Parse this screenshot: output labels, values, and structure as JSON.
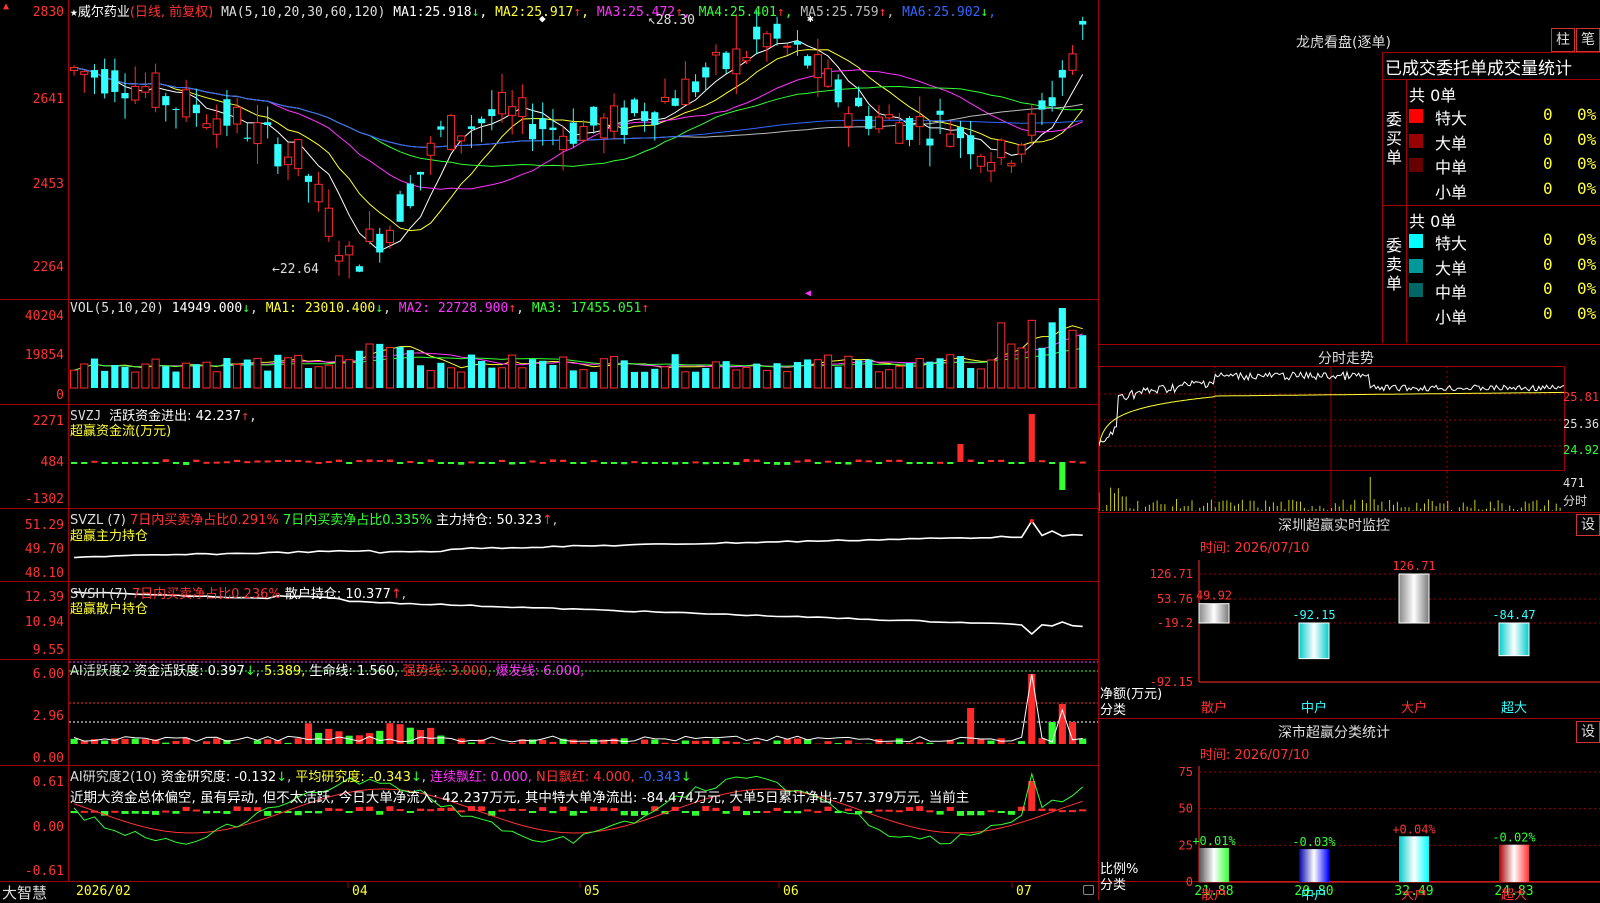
{
  "colors": {
    "up": "#ff2b2b",
    "down": "#33ffff",
    "ma1": "#ffffff",
    "ma2": "#ffff33",
    "ma3": "#ff33ff",
    "ma4": "#33ff33",
    "ma5": "#bbbbbb",
    "ma6": "#3366ff",
    "border": "#a00000"
  },
  "stock": {
    "name": "威尔药业",
    "mode": "(日线, 前复权)",
    "star": "★",
    "flag": "▲"
  },
  "main": {
    "ma_label": "MA(5,10,20,30,60,120)",
    "ma": [
      {
        "label": "MA1:",
        "value": "25.918",
        "arrow": "↓",
        "color": "#ffffff"
      },
      {
        "label": "MA2:",
        "value": "25.917",
        "arrow": "↑",
        "color": "#ffff33"
      },
      {
        "label": "MA3:",
        "value": "25.472",
        "arrow": "↑",
        "color": "#ff33ff"
      },
      {
        "label": "MA4:",
        "value": "25.401",
        "arrow": "↑",
        "color": "#33ff33"
      },
      {
        "label": "MA5:",
        "value": "25.759",
        "arrow": "↑",
        "color": "#bbbbbb"
      },
      {
        "label": "MA6:",
        "value": "25.902",
        "arrow": "↓",
        "color": "#3366ff"
      }
    ],
    "yticks": [
      "2830",
      "2641",
      "2453",
      "2264"
    ],
    "high_label": "28.30",
    "low_label": "22.64",
    "ymin": 22.2,
    "ymax": 28.6
  },
  "vol": {
    "label": "VOL(5,10,20)",
    "value": "14949.000",
    "arrow": "↓",
    "ma1": "MA1: 23010.400",
    "ma1_arrow": "↓",
    "ma2": "MA2: 22728.900",
    "ma2_arrow": "↑",
    "ma3": "MA3: 17455.051",
    "ma3_arrow": "↑",
    "yticks": [
      "40204",
      "19854",
      "0"
    ]
  },
  "svzj": {
    "label": "SVZJ",
    "item": "活跃资金进出: 42.237",
    "arrow": "↑",
    "sub": "超赢资金流(万元)",
    "yticks": [
      "2271",
      "484",
      "-1302"
    ]
  },
  "svzl": {
    "label": "SVZL (7)",
    "item1": "7日内买卖净占比0.291%",
    "item2": "7日内买卖净占比0.335%",
    "item3": "主力持仓: 50.323",
    "arrow": "↑",
    "sub": "超赢主力持仓",
    "yticks": [
      "51.29",
      "49.70",
      "48.10"
    ]
  },
  "svsh": {
    "label": "SVSH (7)",
    "item1": "7日内买卖净占比0.236%",
    "item2": "散户持仓: 10.377",
    "arrow": "↑",
    "sub": "超赢散户持仓",
    "yticks": [
      "12.39",
      "10.94",
      "9.55"
    ]
  },
  "ai1": {
    "label": "AI活跃度2",
    "item1": "资金活跃度: 0.397",
    "a1": "↓",
    "item2": "5.389,",
    "item3": "生命线: 1.560,",
    "item4": "强势线: 3.000,",
    "item5": "爆发线: 6.000,",
    "yticks": [
      "6.00",
      "2.96",
      "0.00"
    ]
  },
  "ai2": {
    "label": "AI研究度2(10)",
    "item1": "资金研究度: -0.132",
    "a1": "↓",
    "item2": "平均研究度: -0.343",
    "a2": "↓",
    "item3": "连续飘红: 0.000,",
    "item4": "N日飘红: 4.000,",
    "item5": "-0.343",
    "a5": "↓",
    "text": "近期大资金总体偏空, 虽有异动, 但不太活跃, 今日大单净流入: 42.237万元, 其中特大单净流出: -84.474万元, 大单5日累计净出-757.379万元, 当前主",
    "yticks": [
      "0.61",
      "0.00",
      "-0.61"
    ]
  },
  "xaxis": {
    "app": "大智慧",
    "labels": [
      "2026/02",
      "04",
      "05",
      "06",
      "07"
    ]
  },
  "dragon": {
    "title": "龙虎看盘(逐单)",
    "btn1": "柱",
    "btn2": "笔",
    "header": "已成交委托单成交量统计",
    "buy": {
      "side": "委买单",
      "total": "共 0单",
      "rows": [
        {
          "name": "特大",
          "color": "#ff0000",
          "v": "0",
          "p": "0%"
        },
        {
          "name": "大单",
          "color": "#990000",
          "v": "0",
          "p": "0%"
        },
        {
          "name": "中单",
          "color": "#660000",
          "v": "0",
          "p": "0%"
        },
        {
          "name": "小单",
          "color": "#000000",
          "v": "0",
          "p": "0%"
        }
      ]
    },
    "sell": {
      "side": "委卖单",
      "total": "共 0单",
      "rows": [
        {
          "name": "特大",
          "color": "#00ffff",
          "v": "0",
          "p": "0%"
        },
        {
          "name": "大单",
          "color": "#009999",
          "v": "0",
          "p": "0%"
        },
        {
          "name": "中单",
          "color": "#006666",
          "v": "0",
          "p": "0%"
        },
        {
          "name": "小单",
          "color": "#000000",
          "v": "0",
          "p": "0%"
        }
      ]
    }
  },
  "intraday": {
    "title": "分时走势",
    "prices": [
      "25.81",
      "25.36",
      "24.92"
    ],
    "vol": "471",
    "vol_label": "分时"
  },
  "monitor": {
    "title": "深圳超赢实时监控",
    "settings": "设",
    "time": "时间: 2026/07/10",
    "yticks": [
      "126.71",
      "53.76",
      "-19.2",
      "-92.15"
    ],
    "ylabel": "净额(万元)",
    "xlabel": "分类",
    "cats": [
      "散户",
      "中户",
      "大户",
      "超大"
    ],
    "labels": [
      "49.92",
      "-92.15",
      "126.71",
      "-84.47"
    ]
  },
  "classify": {
    "title": "深市超赢分类统计",
    "settings": "设",
    "time": "时间: 2026/07/10",
    "yticks": [
      "75",
      "50",
      "25",
      "0"
    ],
    "ylabel": "比例%",
    "xlabel": "分类",
    "cats": [
      "散户",
      "中户",
      "大户",
      "超大"
    ],
    "top": [
      "+0.01%",
      "-0.03%",
      "+0.04%",
      "-0.02%"
    ],
    "bottom": [
      "21.88",
      "20.80",
      "32.49",
      "24.83"
    ],
    "values": [
      21.88,
      20.8,
      32.49,
      24.83
    ],
    "ymax": 75
  }
}
